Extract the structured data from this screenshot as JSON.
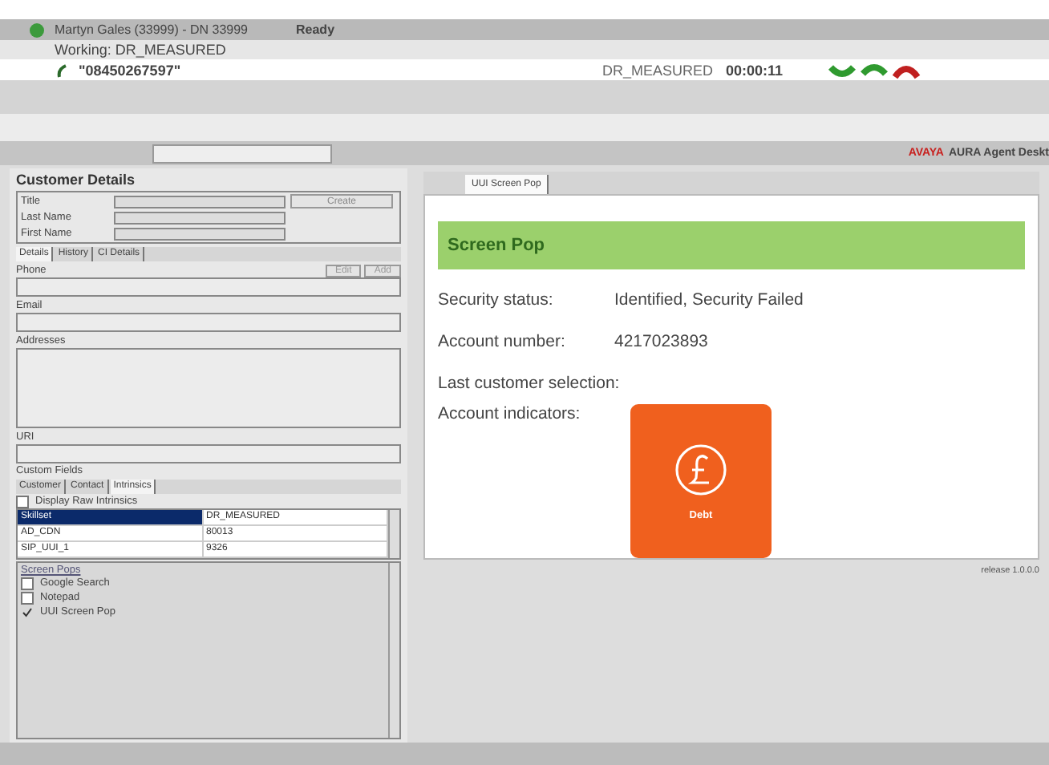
{
  "title_bar": {
    "agent": "Martyn Gales (33999) - DN 33999",
    "status": "Ready"
  },
  "work_line": "Working: DR_MEASURED",
  "call": {
    "number": "\"08450267597\"",
    "skillset": "DR_MEASURED",
    "timer": "00:00:11"
  },
  "brand": {
    "logo": "AVAYA",
    "product": "AURA Agent Deskt"
  },
  "customer": {
    "title": "Customer Details",
    "fields": [
      {
        "label": "Title"
      },
      {
        "label": "Last Name"
      },
      {
        "label": "First Name"
      }
    ],
    "create_button": "Create",
    "tabs": [
      {
        "label": "Details",
        "selected": true
      },
      {
        "label": "History",
        "selected": false
      },
      {
        "label": "CI Details",
        "selected": false
      }
    ],
    "buttons": [
      "Edit",
      "Add"
    ],
    "sections": [
      {
        "label": "Phone",
        "kind": "list"
      },
      {
        "label": "Email",
        "kind": "list"
      },
      {
        "label": "Addresses",
        "kind": "area"
      },
      {
        "label": "URI",
        "kind": "list"
      }
    ],
    "custom_fields": "Custom Fields",
    "custom_tabs": [
      {
        "label": "Customer",
        "selected": false
      },
      {
        "label": "Contact",
        "selected": false
      },
      {
        "label": "Intrinsics",
        "selected": true
      }
    ],
    "raw_intrinsics": {
      "label": "Display Raw Intrinsics",
      "checked": false
    },
    "intrinsics": [
      {
        "name": "Skillset",
        "value": "DR_MEASURED",
        "selected": true
      },
      {
        "name": "AD_CDN",
        "value": "80013",
        "selected": false
      },
      {
        "name": "SIP_UUI_1",
        "value": "9326",
        "selected": false
      }
    ],
    "screen_pops_title": "Screen Pops",
    "screen_pops": [
      {
        "label": "Google Search",
        "checked": false
      },
      {
        "label": "Notepad",
        "checked": false
      },
      {
        "label": "UUI Screen Pop",
        "checked": true
      }
    ]
  },
  "work_tab": {
    "label": "UUI Screen Pop",
    "selected": true
  },
  "screen_pop": {
    "title": "Screen Pop",
    "rows": [
      {
        "label": "Security status:",
        "value": "Identified, Security Failed"
      },
      {
        "label": "Account number:",
        "value": "4217023893"
      },
      {
        "label": "Last customer selection:"
      }
    ],
    "indicators_label": "Account indicators:",
    "indicator": "Debt",
    "version": "release 1.0.0.0"
  }
}
